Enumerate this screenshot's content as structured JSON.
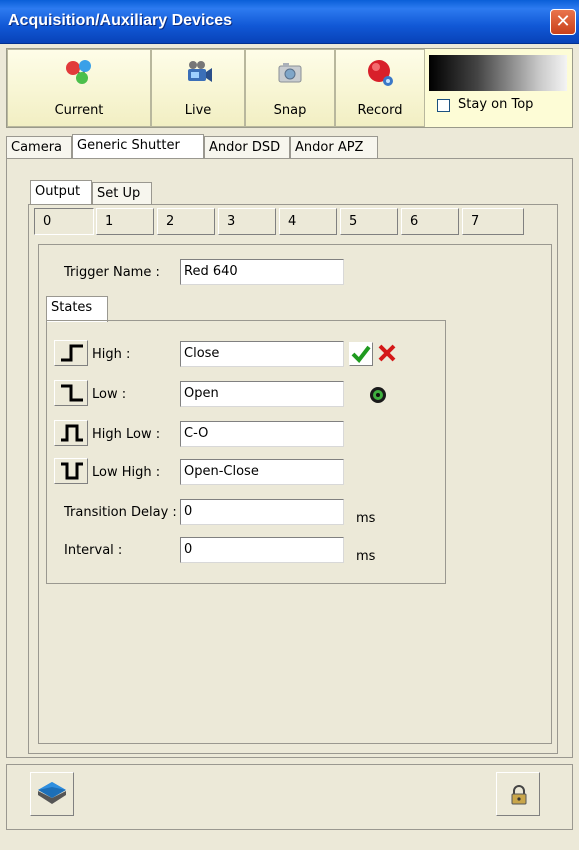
{
  "window": {
    "title": "Acquisition/Auxiliary Devices",
    "close_glyph": "✕"
  },
  "toolbar": {
    "buttons": [
      {
        "label": "Current",
        "icon": "molecule-icon"
      },
      {
        "label": "Live",
        "icon": "video-camera-icon"
      },
      {
        "label": "Snap",
        "icon": "camera-icon"
      },
      {
        "label": "Record",
        "icon": "record-icon"
      }
    ],
    "stay_on_top_label": "Stay on Top",
    "stay_on_top_checked": false
  },
  "device_tabs": [
    "Camera",
    "Generic Shutter",
    "Andor DSD",
    "Andor APZ"
  ],
  "device_tabs_active": "Generic Shutter",
  "sub_tabs": [
    "Output",
    "Set Up"
  ],
  "sub_tabs_active": "Output",
  "channel_tabs": [
    "0",
    "1",
    "2",
    "3",
    "4",
    "5",
    "6",
    "7"
  ],
  "channel_tabs_active": "0",
  "trigger": {
    "label": "Trigger Name :",
    "value": "Red 640"
  },
  "states": {
    "tab_label": "States",
    "rows": [
      {
        "label": "High :",
        "value": "Close",
        "icon": "rising-edge-icon"
      },
      {
        "label": "Low :",
        "value": "Open",
        "icon": "falling-edge-icon"
      },
      {
        "label": "High Low :",
        "value": "C-O",
        "icon": "pulse-high-icon"
      },
      {
        "label": "Low High :",
        "value": "Open-Close",
        "icon": "pulse-low-icon"
      }
    ],
    "transition_delay": {
      "label": "Transition Delay :",
      "value": "0",
      "unit": "ms"
    },
    "interval": {
      "label": "Interval :",
      "value": "0",
      "unit": "ms"
    }
  },
  "colors": {
    "accent_title": "#0a5fd8",
    "confirm_green": "#1f9a1f",
    "cancel_red": "#d41818"
  }
}
